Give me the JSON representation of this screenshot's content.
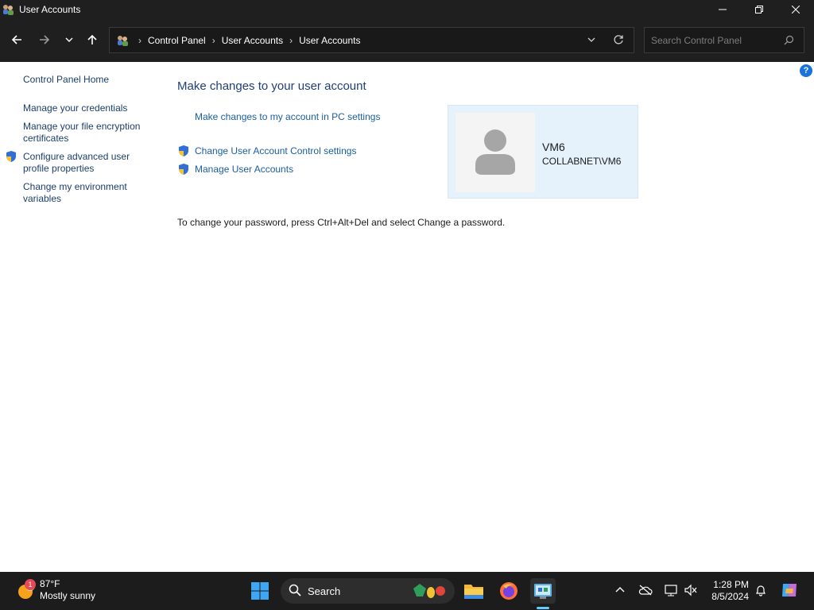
{
  "window": {
    "title": "User Accounts",
    "controls": [
      "minimize",
      "restore",
      "close"
    ]
  },
  "address_bar": {
    "breadcrumbs": [
      "Control Panel",
      "User Accounts",
      "User Accounts"
    ]
  },
  "search": {
    "placeholder": "Search Control Panel"
  },
  "sidebar": {
    "home": "Control Panel Home",
    "links": [
      {
        "label": "Manage your credentials"
      },
      {
        "label": "Manage your file encryption certificates"
      },
      {
        "label": "Configure advanced user profile properties",
        "icon": "shield-icon"
      },
      {
        "label": "Change my environment variables"
      }
    ]
  },
  "main": {
    "title": "Make changes to your user account",
    "pc_settings_link": "Make changes to my account in PC settings",
    "uac_link": "Change User Account Control settings",
    "manage_link": "Manage User Accounts",
    "password_info": "To change your password, press Ctrl+Alt+Del and select Change a password."
  },
  "user": {
    "name": "VM6",
    "domain": "COLLABNET\\VM6"
  },
  "taskbar": {
    "weather_temp": "87°F",
    "weather_condition": "Mostly sunny",
    "weather_badge": "1",
    "search_label": "Search",
    "time": "1:28 PM",
    "date": "8/5/2024"
  },
  "colors": {
    "title_bar": "#1f1f1f",
    "link": "#1a5ea0",
    "heading": "#1e3f78",
    "user_card": "#e5f1fb",
    "taskbar": "#1c1c1c"
  }
}
